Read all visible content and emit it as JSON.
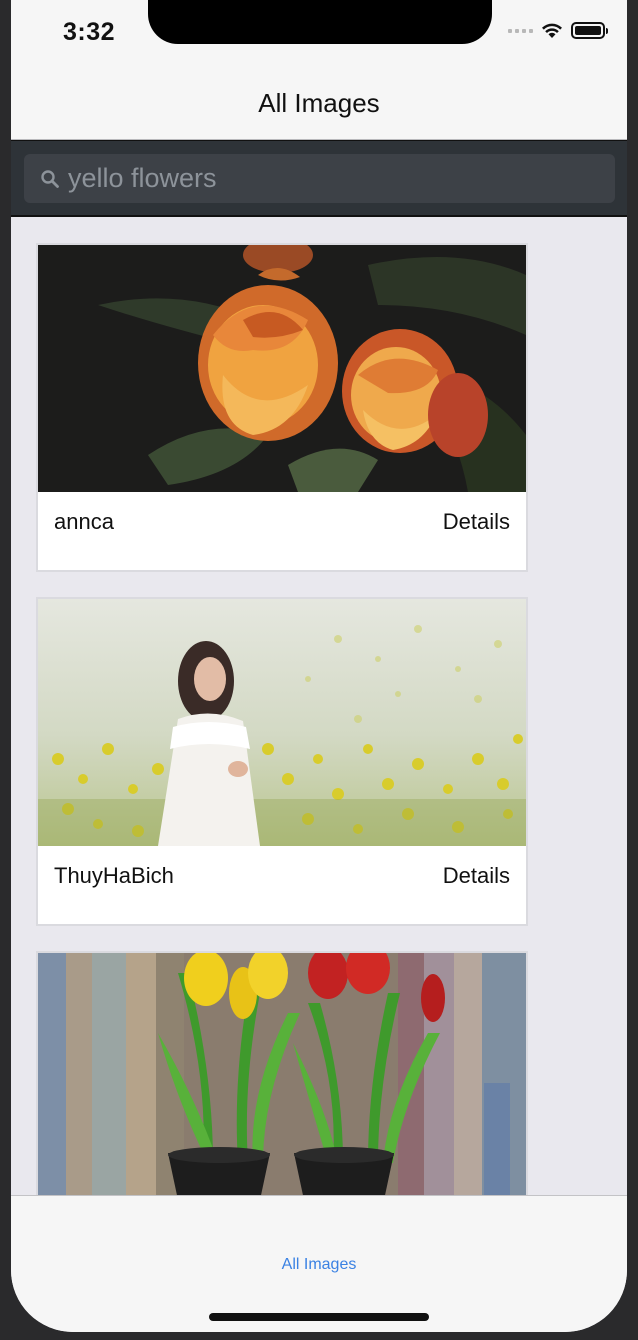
{
  "status_bar": {
    "time": "3:32"
  },
  "nav": {
    "title": "All Images"
  },
  "search": {
    "value": "yello flowers"
  },
  "cards": [
    {
      "author": "annca",
      "details_label": "Details",
      "image": "orange-roses-photo"
    },
    {
      "author": "ThuyHaBich",
      "details_label": "Details",
      "image": "woman-in-yellow-flower-field-photo"
    },
    {
      "author": "",
      "details_label": "",
      "image": "tulips-in-pots-photo"
    }
  ],
  "tab_bar": {
    "items": [
      {
        "label": "All Images",
        "active": true
      }
    ]
  },
  "colors": {
    "accent": "#3b82e3",
    "search_bar_bg": "#2e3338",
    "list_bg": "#e9e8ee"
  }
}
